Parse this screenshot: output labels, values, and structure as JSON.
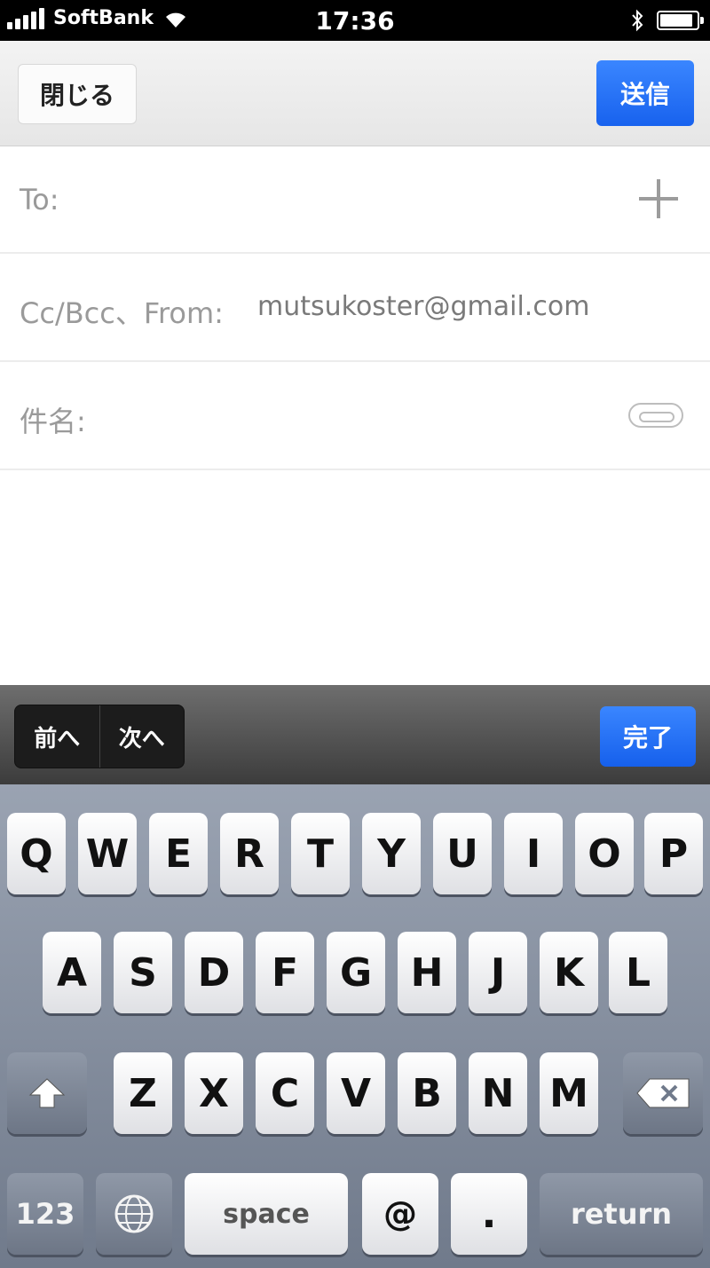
{
  "status_bar": {
    "carrier": "SoftBank",
    "time": "17:36"
  },
  "nav": {
    "close_label": "閉じる",
    "send_label": "送信"
  },
  "fields": {
    "to_label": "To:",
    "cc_label": "Cc/Bcc、From:",
    "from_value": "mutsukoster@gmail.com",
    "subject_label": "件名:"
  },
  "toolbar": {
    "prev_label": "前へ",
    "next_label": "次へ",
    "done_label": "完了"
  },
  "keyboard": {
    "row1": [
      "Q",
      "W",
      "E",
      "R",
      "T",
      "Y",
      "U",
      "I",
      "O",
      "P"
    ],
    "row2": [
      "A",
      "S",
      "D",
      "F",
      "G",
      "H",
      "J",
      "K",
      "L"
    ],
    "row3": [
      "Z",
      "X",
      "C",
      "V",
      "B",
      "N",
      "M"
    ],
    "numbers_label": "123",
    "space_label": "space",
    "at_label": "@",
    "dot_label": ".",
    "return_label": "return"
  },
  "colors": {
    "accent_blue": "#1862ee",
    "keyboard_bg": "#8a93a3",
    "status_bar_bg": "#000000"
  }
}
